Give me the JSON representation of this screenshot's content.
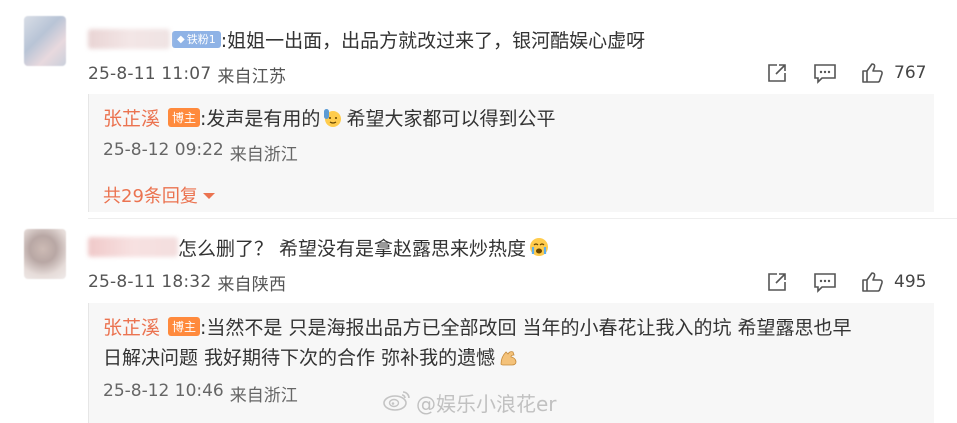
{
  "comments": [
    {
      "author_badge": "铁粉1",
      "content": ":姐姐一出面，出品方就改过来了，银河酷娱心虚呀",
      "time": "25-8-11 11:07",
      "location": "来自江苏",
      "likes": "767",
      "replies": [
        {
          "author": "张芷溪",
          "badge": "博主",
          "text_before_emoji": ":发声是有用的",
          "emoji": "raise-hand-emoji",
          "text_after_emoji": " 希望大家都可以得到公平",
          "time": "25-8-12 09:22",
          "location": "来自浙江"
        }
      ],
      "more_replies": "共29条回复"
    },
    {
      "content": "怎么删了？ 希望没有是拿赵露思来炒热度",
      "emoji": "crying-emoji",
      "time": "25-8-11 18:32",
      "location": "来自陕西",
      "likes": "495",
      "replies": [
        {
          "author": "张芷溪",
          "badge": "博主",
          "line1": ":当然不是   只是海报出品方已全部改回 当年的小春花让我入的坑 希望露思也早",
          "line2": "日解决问题 我好期待下次的合作 弥补我的遗憾",
          "emoji": "flexed-biceps-emoji",
          "time": "25-8-12 10:46",
          "location": "来自浙江"
        }
      ]
    }
  ],
  "watermark": "@娱乐小浪花er",
  "colors": {
    "accent": "#eb7350",
    "host_badge": "#ff8a3d",
    "fan_badge": "#8fb3e6"
  }
}
